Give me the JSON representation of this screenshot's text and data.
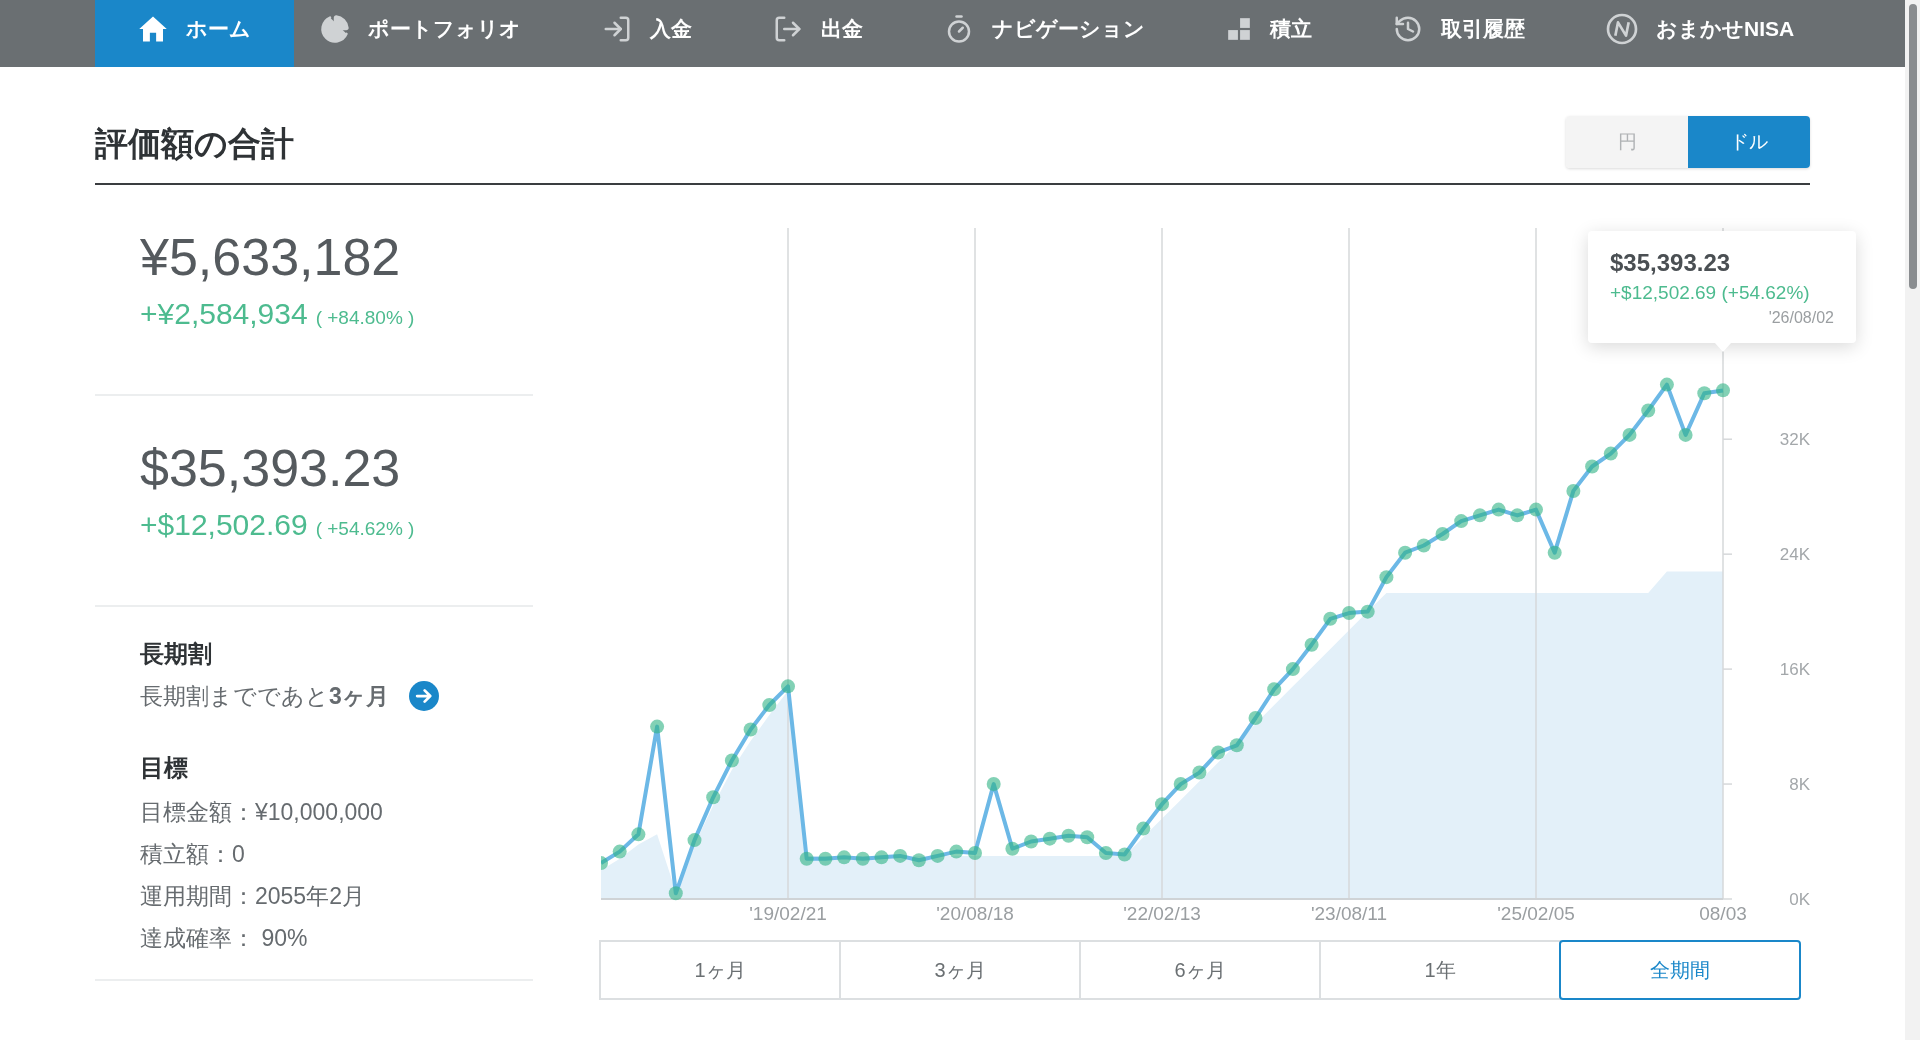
{
  "nav": {
    "items": [
      {
        "label": "ホーム",
        "selected": true
      },
      {
        "label": "ポートフォリオ",
        "selected": false
      },
      {
        "label": "入金",
        "selected": false
      },
      {
        "label": "出金",
        "selected": false
      },
      {
        "label": "ナビゲーション",
        "selected": false
      },
      {
        "label": "積立",
        "selected": false
      },
      {
        "label": "取引履歴",
        "selected": false
      },
      {
        "label": "おまかせNISA",
        "selected": false
      }
    ]
  },
  "header": {
    "title": "評価額の合計",
    "currency_toggle": [
      {
        "label": "円",
        "selected": false
      },
      {
        "label": "ドル",
        "selected": true
      }
    ]
  },
  "summary": [
    {
      "total": "¥5,633,182",
      "gain": "+¥2,584,934",
      "gain_pct": "( +84.80% )"
    },
    {
      "total": "$35,393.23",
      "gain": "+$12,502.69",
      "gain_pct": "( +54.62% )"
    }
  ],
  "long_term": {
    "title": "長期割",
    "text": "長期割までであと**3ヶ月**"
  },
  "goal": {
    "title": "目標",
    "lines": [
      "目標金額：¥10,000,000",
      "積立額：0",
      "運用期間：2055年2月",
      "達成確率： 90%"
    ]
  },
  "chart": {
    "tooltip": {
      "value": "$35,393.23",
      "change": "+$12,502.69 (+54.62%)",
      "date": "'26/08/02"
    },
    "chart_data": {
      "type": "line",
      "ylim": [
        0,
        46700
      ],
      "grid": true,
      "categories": [
        null,
        null,
        null,
        null,
        null,
        null,
        null,
        null,
        null,
        null,
        "'19/02/21",
        null,
        null,
        null,
        null,
        null,
        null,
        null,
        null,
        null,
        "'20/08/18",
        null,
        null,
        null,
        null,
        null,
        null,
        null,
        null,
        null,
        "'22/02/13",
        null,
        null,
        null,
        null,
        null,
        null,
        null,
        null,
        null,
        "'23/08/11",
        null,
        null,
        null,
        null,
        null,
        null,
        null,
        null,
        null,
        "'25/02/05",
        null,
        null,
        null,
        null,
        null,
        null,
        null,
        null,
        null,
        "08/03"
      ],
      "yticks": [
        {
          "value": 0,
          "label": "0K"
        },
        {
          "value": 8000,
          "label": "8K"
        },
        {
          "value": 16000,
          "label": "16K"
        },
        {
          "value": 24000,
          "label": "24K"
        },
        {
          "value": 32000,
          "label": "32K"
        }
      ],
      "series": [
        {
          "type": "line",
          "color": "#6cb8e6",
          "marker": "circle",
          "values": [
            2500,
            3300,
            4500,
            12000,
            400,
            4100,
            7080,
            9640,
            11800,
            13500,
            14800,
            2800,
            2800,
            2900,
            2800,
            2900,
            3000,
            2700,
            3000,
            3300,
            3200,
            8000,
            3500,
            4000,
            4200,
            4400,
            4300,
            3200,
            3100,
            4900,
            6600,
            8000,
            8800,
            10200,
            10700,
            12600,
            14600,
            16000,
            17700,
            19500,
            19900,
            20000,
            22400,
            24100,
            24600,
            25400,
            26300,
            26700,
            27100,
            26700,
            27100,
            24100,
            28400,
            30100,
            31000,
            32300,
            34000,
            35800,
            32300,
            35200,
            35400
          ]
        },
        {
          "type": "area",
          "color": "#e3f0f9",
          "values": [
            2000,
            2800,
            3800,
            4500,
            500,
            3800,
            6500,
            9000,
            11000,
            12800,
            14500,
            3000,
            3000,
            3000,
            3000,
            3000,
            3000,
            3000,
            3000,
            3000,
            3000,
            3000,
            3000,
            3000,
            3000,
            3000,
            3000,
            3000,
            3000,
            4300,
            5600,
            6900,
            8200,
            9500,
            10800,
            12200,
            13500,
            14800,
            16100,
            17400,
            18700,
            20000,
            21300,
            21300,
            21300,
            21300,
            21300,
            21300,
            21300,
            21300,
            21300,
            21300,
            21300,
            21300,
            21300,
            21300,
            21300,
            22800,
            22800,
            22800,
            22800
          ]
        }
      ]
    }
  },
  "periods": [
    {
      "label": "1ヶ月",
      "selected": false
    },
    {
      "label": "3ヶ月",
      "selected": false
    },
    {
      "label": "6ヶ月",
      "selected": false
    },
    {
      "label": "1年",
      "selected": false
    },
    {
      "label": "全期間",
      "selected": true
    }
  ]
}
